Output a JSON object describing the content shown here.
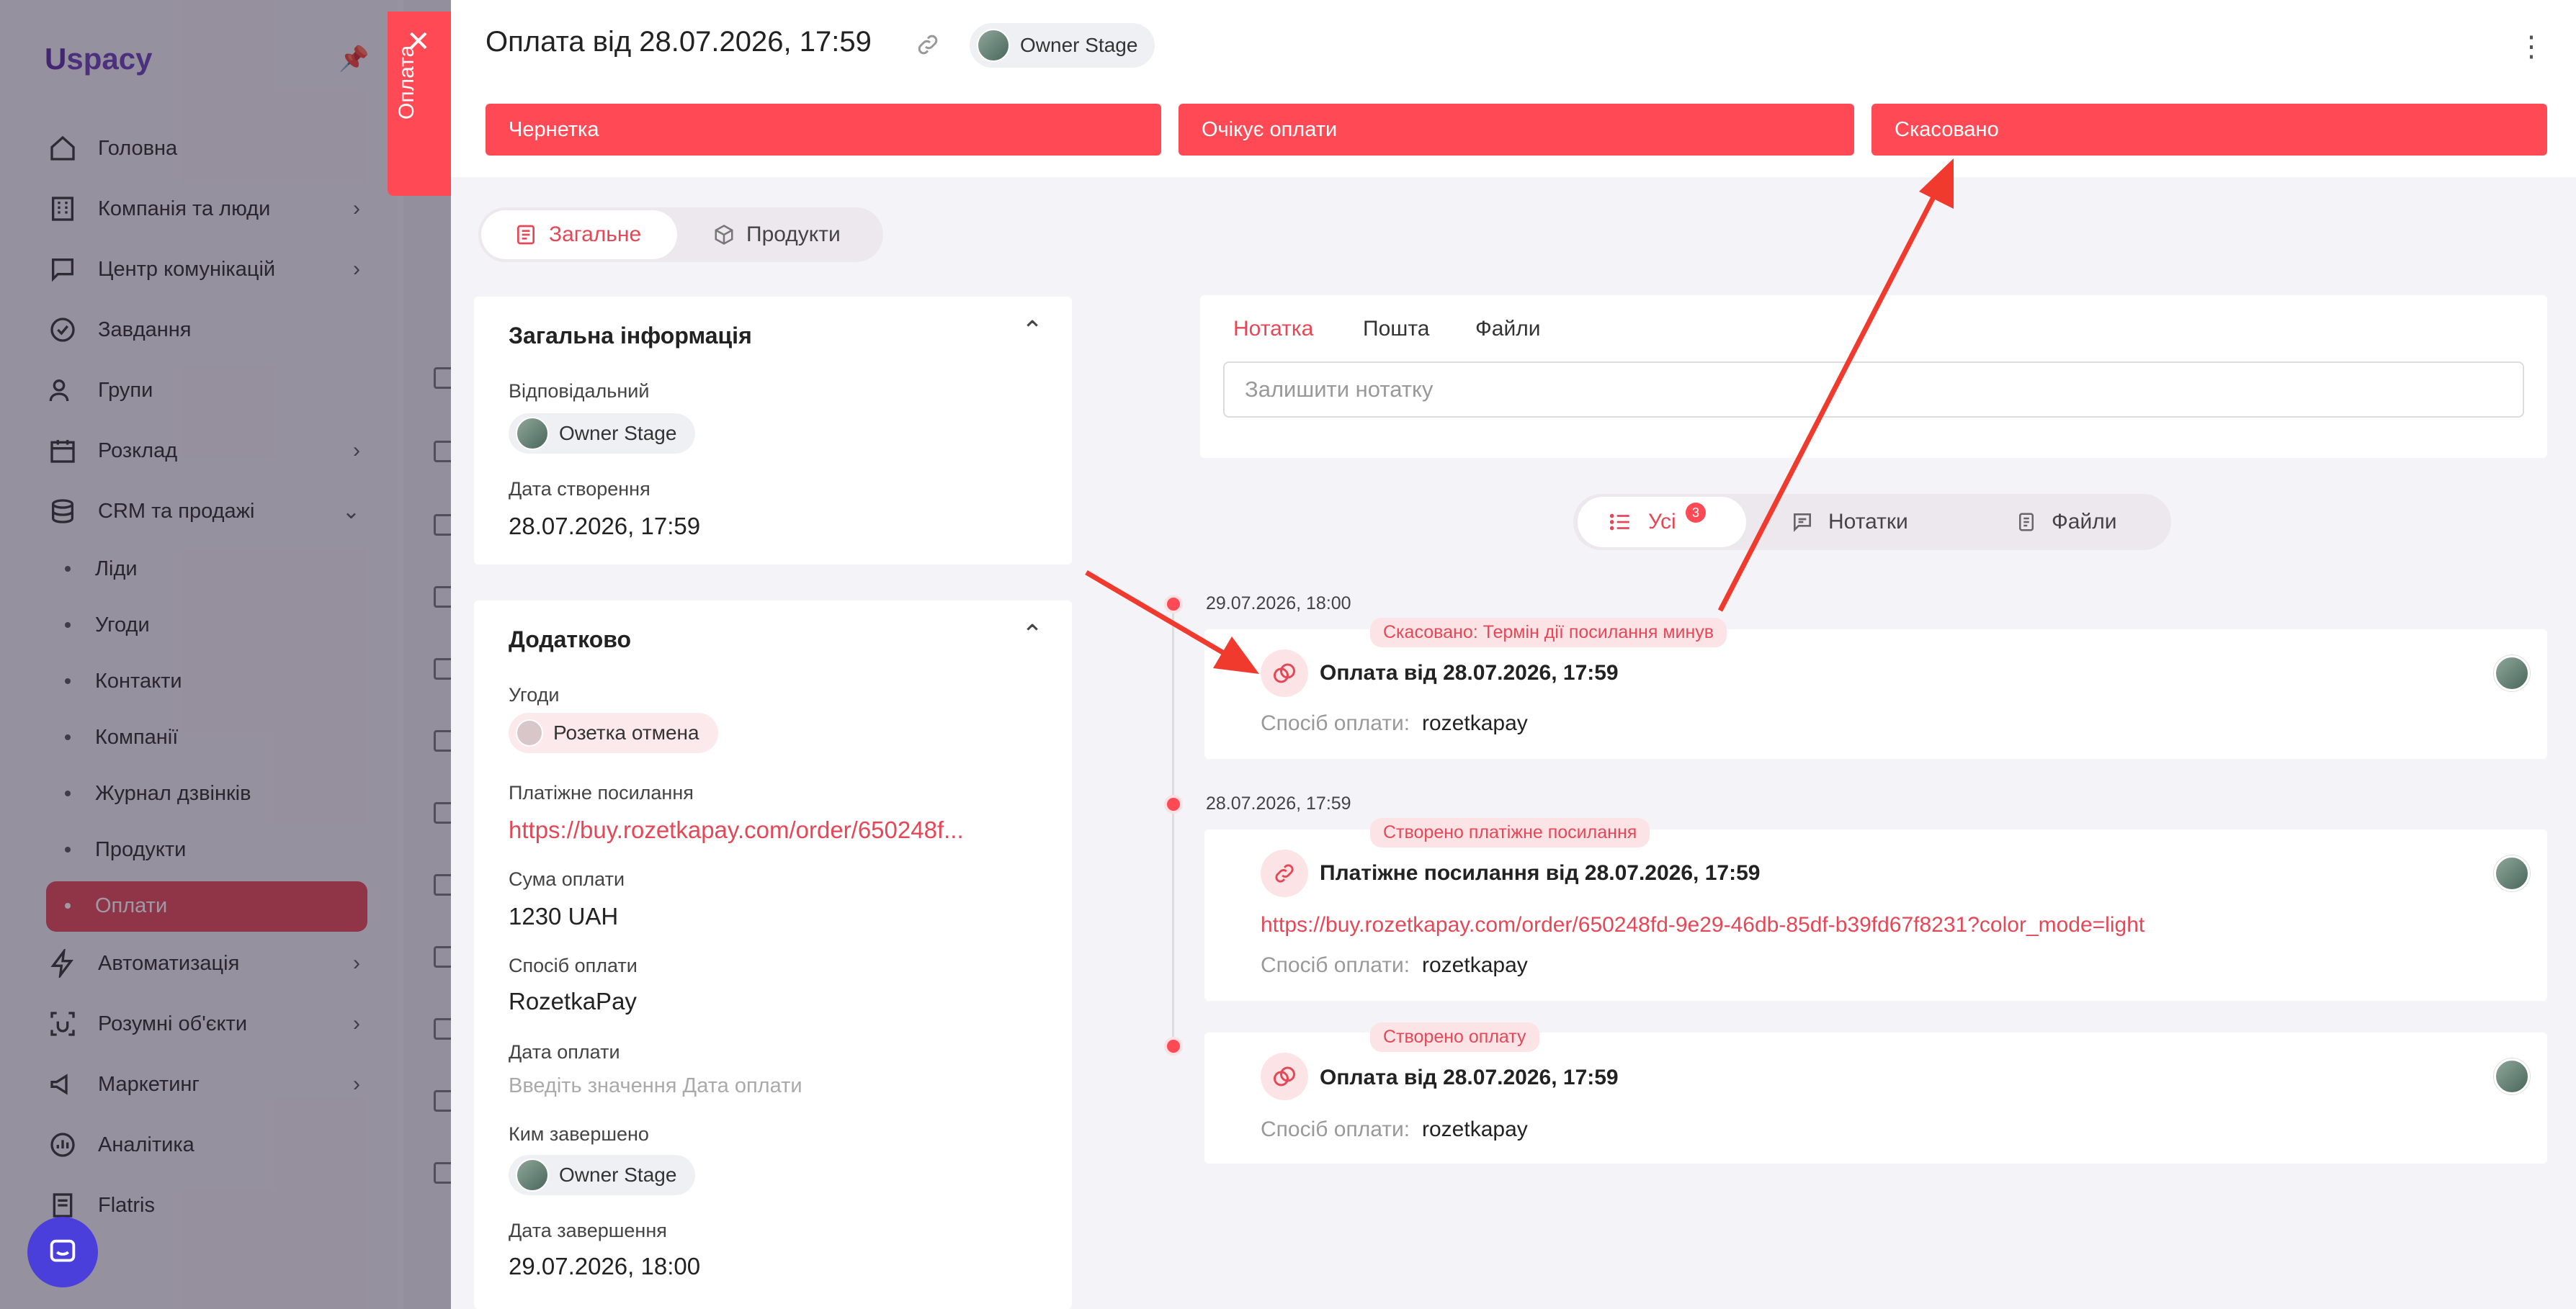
{
  "brand": {
    "logo": "spacy",
    "accent": "#ff4a55",
    "text_red": "#e64756"
  },
  "sidebar": {
    "items": [
      {
        "label": "Головна",
        "icon": "home-icon"
      },
      {
        "label": "Компанія та люди",
        "icon": "building-icon"
      },
      {
        "label": "Центр комунікацій",
        "icon": "chat-icon"
      },
      {
        "label": "Завдання",
        "icon": "check-circle-icon"
      },
      {
        "label": "Групи",
        "icon": "users-icon"
      },
      {
        "label": "Розклад",
        "icon": "calendar-icon"
      },
      {
        "label": "CRM та продажі",
        "icon": "database-icon"
      },
      {
        "label": "Автоматизація",
        "icon": "bolt-icon"
      },
      {
        "label": "Розумні об'єкти",
        "icon": "smart-object-icon"
      },
      {
        "label": "Маркетинг",
        "icon": "megaphone-icon"
      },
      {
        "label": "Аналітика",
        "icon": "analytics-icon"
      },
      {
        "label": "Flatris",
        "icon": "document-icon"
      }
    ],
    "crm_sub": [
      "Ліди",
      "Угоди",
      "Контакти",
      "Компанії",
      "Журнал дзвінків",
      "Продукти",
      "Оплати"
    ]
  },
  "side_tab": {
    "label": "Оплата"
  },
  "header": {
    "title": "Оплата від 28.07.2026, 17:59",
    "owner": "Owner Stage"
  },
  "stages": [
    "Чернетка",
    "Очікує оплати",
    "Скасовано"
  ],
  "tabs": {
    "general": "Загальне",
    "products": "Продукти"
  },
  "general_info": {
    "title": "Загальна інформація",
    "responsible_label": "Відповідальний",
    "responsible": "Owner Stage",
    "created_label": "Дата створення",
    "created": "28.07.2026, 17:59"
  },
  "additional": {
    "title": "Додатково",
    "deals_label": "Угоди",
    "deal": "Розетка отмена",
    "payment_link_label": "Платіжне посилання",
    "payment_link": "https://buy.rozetkapay.com/order/650248f...",
    "amount_label": "Сума оплати",
    "amount": "1230 UAH",
    "method_label": "Спосіб оплати",
    "method": "RozetkaPay",
    "paid_date_label": "Дата оплати",
    "paid_date_placeholder": "Введіть значення Дата оплати",
    "completed_by_label": "Ким завершено",
    "completed_by": "Owner Stage",
    "completed_date_label": "Дата завершення",
    "completed_date": "29.07.2026, 18:00"
  },
  "note": {
    "tabs": [
      "Нотатка",
      "Пошта",
      "Файли"
    ],
    "placeholder": "Залишити нотатку"
  },
  "filter": {
    "all": "Усі",
    "all_count": "3",
    "notes": "Нотатки",
    "files": "Файли"
  },
  "timeline": [
    {
      "date": "29.07.2026, 18:00",
      "tag": "Скасовано: Термін дії посилання минув",
      "title": "Оплата від 28.07.2026, 17:59",
      "method_label": "Спосіб оплати:",
      "method": "rozetkapay"
    },
    {
      "date": "28.07.2026, 17:59",
      "tag": "Створено платіжне посилання",
      "title": "Платіжне посилання від 28.07.2026, 17:59",
      "link": "https://buy.rozetkapay.com/order/650248fd-9e29-46db-85df-b39fd67f8231?color_mode=light",
      "method_label": "Спосіб оплати:",
      "method": "rozetkapay"
    },
    {
      "date": "",
      "tag": "Створено оплату",
      "title": "Оплата від 28.07.2026, 17:59",
      "method_label": "Спосіб оплати:",
      "method": "rozetkapay"
    }
  ]
}
